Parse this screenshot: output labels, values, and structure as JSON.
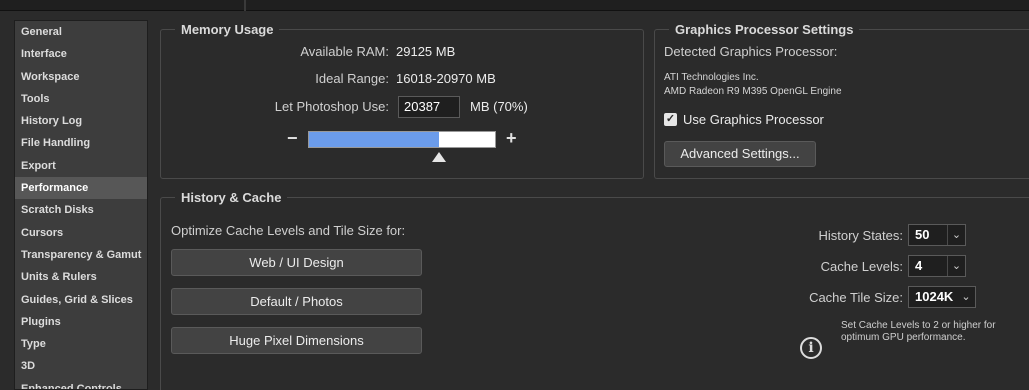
{
  "sidebar": {
    "items": [
      {
        "label": "General"
      },
      {
        "label": "Interface"
      },
      {
        "label": "Workspace"
      },
      {
        "label": "Tools"
      },
      {
        "label": "History Log"
      },
      {
        "label": "File Handling"
      },
      {
        "label": "Export"
      },
      {
        "label": "Performance"
      },
      {
        "label": "Scratch Disks"
      },
      {
        "label": "Cursors"
      },
      {
        "label": "Transparency & Gamut"
      },
      {
        "label": "Units & Rulers"
      },
      {
        "label": "Guides, Grid & Slices"
      },
      {
        "label": "Plugins"
      },
      {
        "label": "Type"
      },
      {
        "label": "3D"
      },
      {
        "label": "Enhanced Controls"
      }
    ],
    "selected": "Performance"
  },
  "memory": {
    "title": "Memory Usage",
    "available_label": "Available RAM:",
    "available_value": "29125 MB",
    "ideal_label": "Ideal Range:",
    "ideal_value": "16018-20970 MB",
    "use_label": "Let Photoshop Use:",
    "use_value": "20387",
    "use_suffix": "MB (70%)",
    "minus": "−",
    "plus": "+",
    "slider_fraction": 0.7
  },
  "gpu": {
    "title": "Graphics Processor Settings",
    "detected_label": "Detected Graphics Processor:",
    "vendor": "ATI Technologies Inc.",
    "model": "AMD Radeon R9 M395 OpenGL Engine",
    "use_gpu_label": "Use Graphics Processor",
    "use_gpu_checked": true,
    "check_glyph": "✓",
    "advanced_button": "Advanced Settings..."
  },
  "history_cache": {
    "title": "History & Cache",
    "optimize_label": "Optimize Cache Levels and Tile Size for:",
    "presets": [
      "Web / UI Design",
      "Default / Photos",
      "Huge Pixel Dimensions"
    ],
    "history_states_label": "History States:",
    "history_states_value": "50",
    "cache_levels_label": "Cache Levels:",
    "cache_levels_value": "4",
    "cache_tile_label": "Cache Tile Size:",
    "cache_tile_value": "1024K",
    "chevron": "⌄",
    "info_glyph": "i",
    "info_line1": "Set Cache Levels to 2 or higher for",
    "info_line2": "optimum GPU performance."
  },
  "colors": {
    "background": "#2b2b2b",
    "sidebar": "#3d3d3d",
    "selected_item": "#575757",
    "slider_fill": "#6b9ceb"
  }
}
